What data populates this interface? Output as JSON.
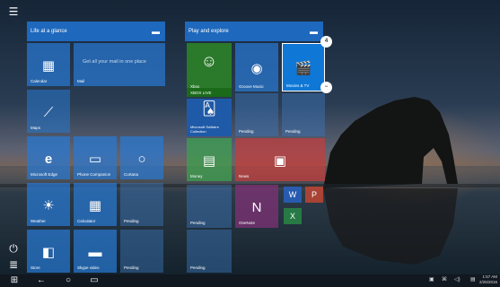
{
  "groups": {
    "life": {
      "title": "Life at a glance"
    },
    "play": {
      "title": "Play and explore"
    }
  },
  "tiles": {
    "calendar": "Calendar",
    "mail": "Mail",
    "mail_text": "Get all your mail in one place",
    "maps": "Maps",
    "edge": "Microsoft Edge",
    "phone": "Phone Companion",
    "cortana": "Cortana",
    "weather": "Weather",
    "calculator": "Calculator",
    "pending1": "Pending",
    "store": "Store",
    "skype": "Skype video",
    "pending2": "Pending",
    "xbox": "Xbox",
    "xbox_live": "XBOX LIVE",
    "groove": "Groove Music",
    "movies": "Movies & TV",
    "solitaire": "Microsoft Solitaire Collection",
    "pending3": "Pending",
    "pending4": "Pending",
    "monthly": "Money",
    "news": "News",
    "pending5": "Pending",
    "onenote": "OneNote",
    "pending6": "Pending"
  },
  "badges": {
    "movies": "4",
    "minus": "−"
  },
  "taskbar": {
    "clock_time": "1:57 AM",
    "clock_date": "2/25/2016"
  },
  "colors": {
    "accent": "#1e6ec8",
    "taskbar": "#111820"
  }
}
